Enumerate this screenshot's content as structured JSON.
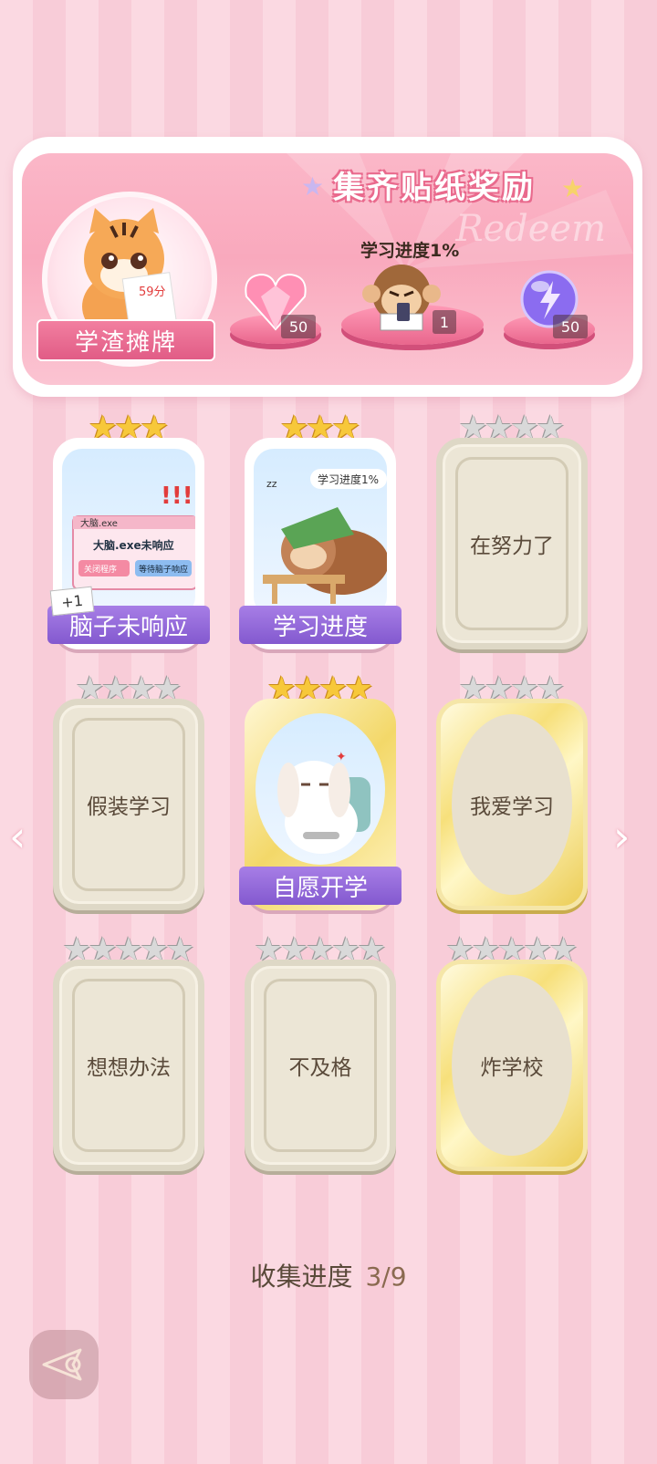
{
  "banner": {
    "title": "集齐贴纸奖励",
    "watermark": "Redeem",
    "main_reward_label": "学渣摊牌",
    "main_reward_score": "59分",
    "progress_label": "学习进度1%",
    "rewards": [
      {
        "icon": "heart-gem-icon",
        "count": "50"
      },
      {
        "icon": "monkey-sticker-icon",
        "count": "1"
      },
      {
        "icon": "energy-orb-icon",
        "count": "50"
      }
    ]
  },
  "cards": [
    {
      "name": "脑子未响应",
      "unlocked": true,
      "stars": 3,
      "art": "computer-popup",
      "popup_title": "大脑.exe",
      "popup_text": "大脑.exe未响应",
      "btn1": "关闭程序",
      "btn2": "等待脑子响应"
    },
    {
      "name": "学习进度",
      "unlocked": true,
      "stars": 3,
      "art": "sloth",
      "bubble": "学习进度1%"
    },
    {
      "name": "在努力了",
      "unlocked": false,
      "stars": 4
    },
    {
      "name": "假装学习",
      "unlocked": false,
      "stars": 4
    },
    {
      "name": "自愿开学",
      "unlocked": true,
      "stars": 4,
      "art": "bunny"
    },
    {
      "name": "我爱学习",
      "unlocked": false,
      "stars": 4
    },
    {
      "name": "想想办法",
      "unlocked": false,
      "stars": 5
    },
    {
      "name": "不及格",
      "unlocked": false,
      "stars": 5
    },
    {
      "name": "炸学校",
      "unlocked": false,
      "stars": 5
    }
  ],
  "plus_badge": "+1",
  "collect": {
    "label": "收集进度",
    "value": "3/9"
  },
  "nav": {
    "prev_icon": "chevron-left-icon",
    "next_icon": "chevron-right-icon",
    "back_icon": "back-arrow-icon"
  },
  "colors": {
    "accent": "#f27fa0",
    "title_bar": "#8359cf",
    "star_gold": "#f7c83a"
  }
}
